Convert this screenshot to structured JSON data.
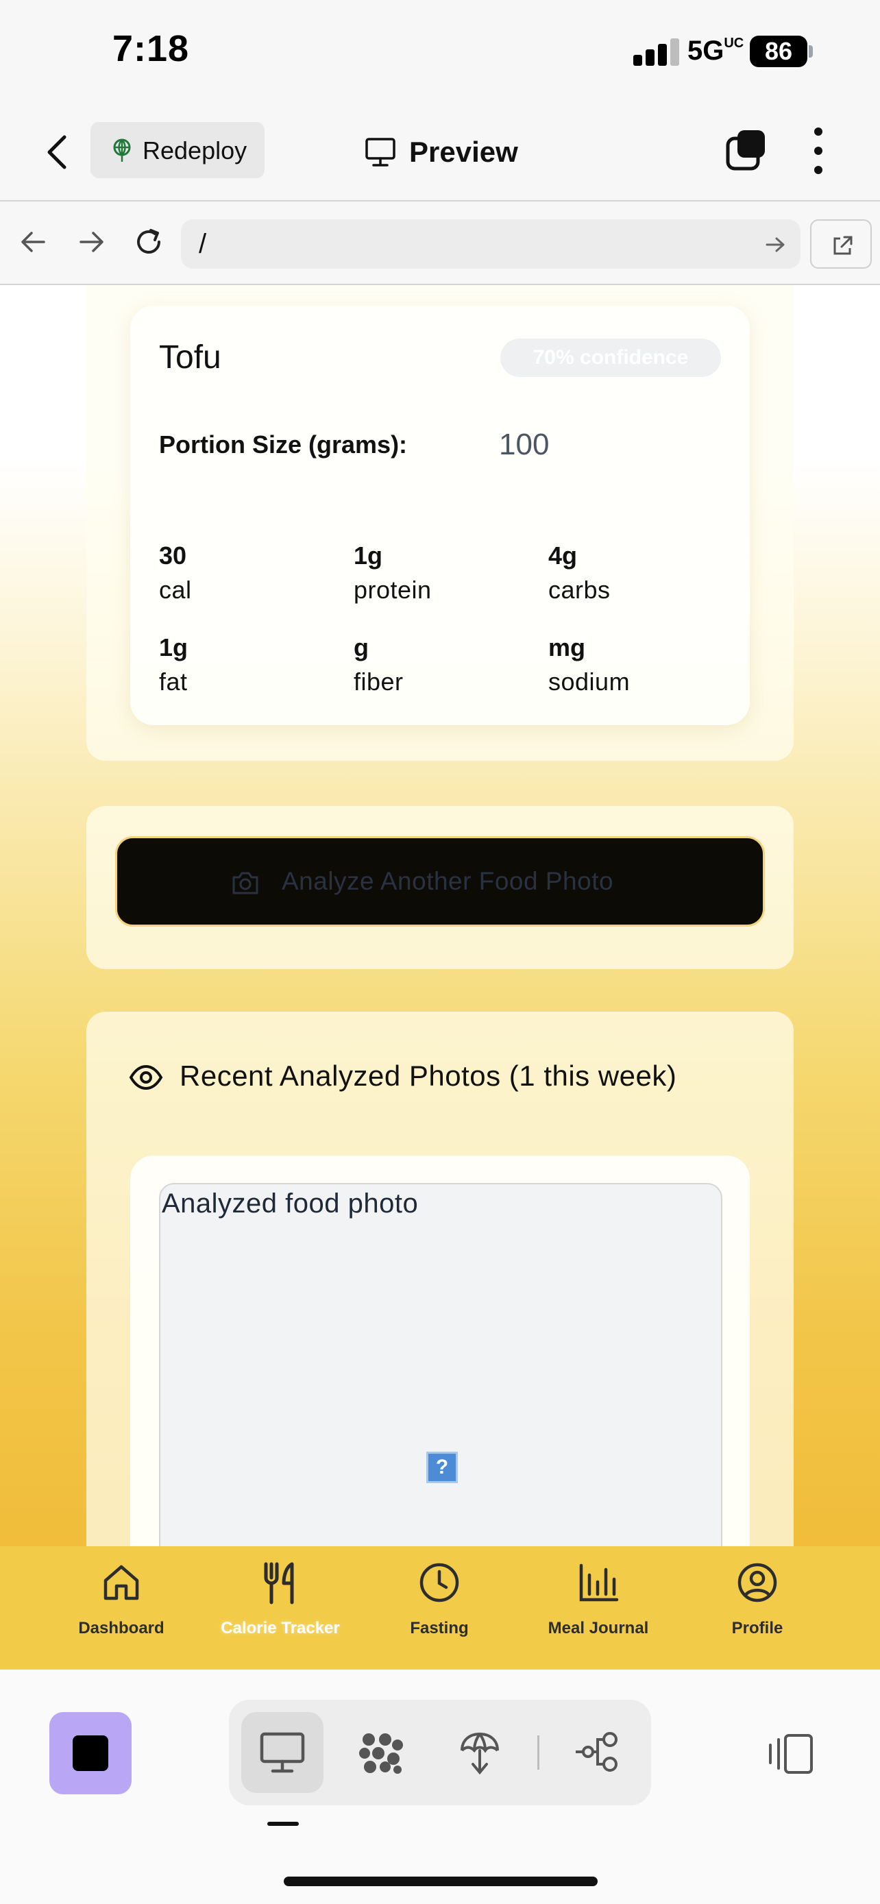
{
  "status_bar": {
    "time": "7:18",
    "network": "5G",
    "network_sup": "UC",
    "battery": "86"
  },
  "header": {
    "redeploy_label": "Redeploy",
    "preview_label": "Preview"
  },
  "url_bar": {
    "url": "/"
  },
  "nutrition": {
    "food_name": "Tofu",
    "confidence": "70% confidence",
    "portion_label": "Portion Size (grams):",
    "portion_value": "100",
    "nutrients": [
      {
        "value": "30",
        "unit": "cal"
      },
      {
        "value": "1g",
        "unit": "protein"
      },
      {
        "value": "4g",
        "unit": "carbs"
      },
      {
        "value": "1g",
        "unit": "fat"
      },
      {
        "value": "g",
        "unit": "fiber"
      },
      {
        "value": "mg",
        "unit": "sodium"
      }
    ]
  },
  "analyze": {
    "label": "Analyze Another Food Photo"
  },
  "recent": {
    "title": "Recent Analyzed Photos (1 this week)",
    "photo_alt": "Analyzed food photo",
    "broken_image_glyph": "?"
  },
  "bottom_nav": {
    "items": [
      {
        "label": "Dashboard",
        "icon": "home-icon"
      },
      {
        "label": "Calorie Tracker",
        "icon": "utensils-icon",
        "active": true
      },
      {
        "label": "Fasting",
        "icon": "clock-icon"
      },
      {
        "label": "Meal Journal",
        "icon": "bar-chart-icon"
      },
      {
        "label": "Profile",
        "icon": "user-circle-icon"
      }
    ]
  },
  "colors": {
    "nav_background": "#f2cc48",
    "analyze_button": "#0d0b06",
    "stop_button": "#b9a6f5"
  }
}
